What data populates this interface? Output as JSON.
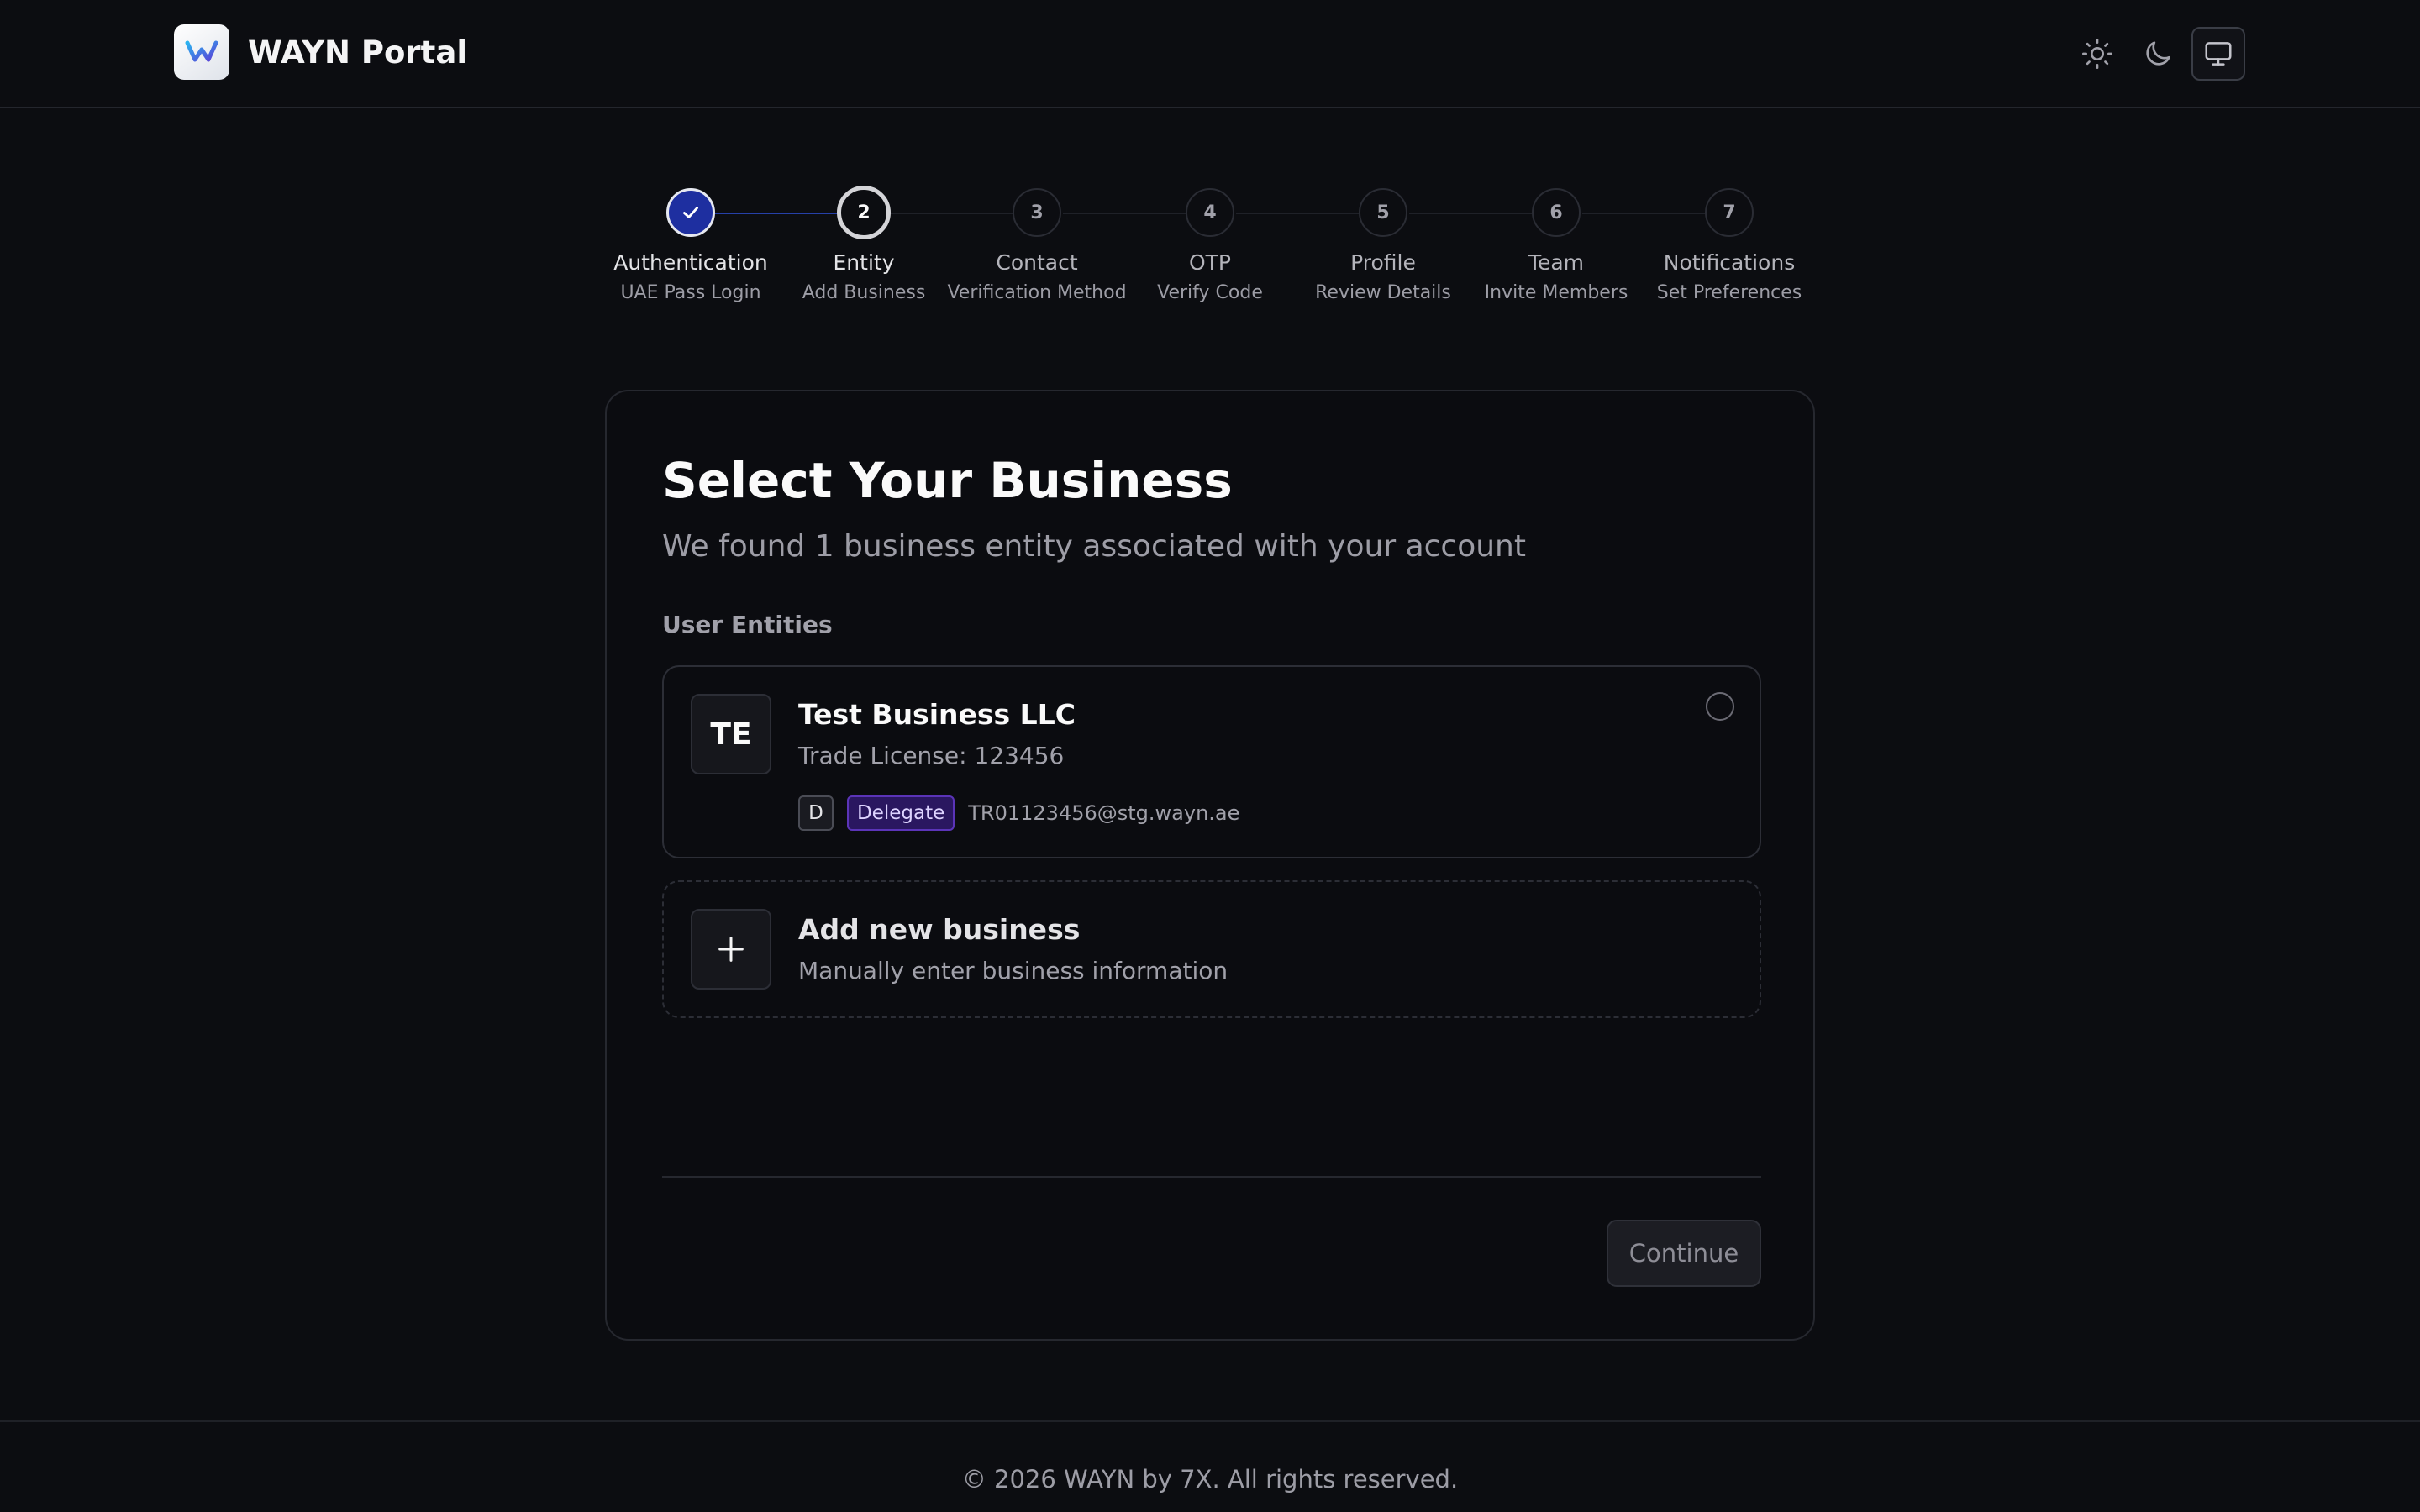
{
  "app": {
    "title": "WAYN Portal",
    "logo_icon": "wayn-logo-icon"
  },
  "theme_toggle": {
    "options": [
      "light-theme-icon",
      "dark-theme-icon",
      "system-theme-icon"
    ],
    "selected": "system"
  },
  "stepper": {
    "steps": [
      {
        "number": "1",
        "label": "Authentication",
        "sub": "UAE Pass Login",
        "state": "done"
      },
      {
        "number": "2",
        "label": "Entity",
        "sub": "Add Business",
        "state": "current"
      },
      {
        "number": "3",
        "label": "Contact",
        "sub": "Verification Method",
        "state": "future"
      },
      {
        "number": "4",
        "label": "OTP",
        "sub": "Verify Code",
        "state": "future"
      },
      {
        "number": "5",
        "label": "Profile",
        "sub": "Review Details",
        "state": "future"
      },
      {
        "number": "6",
        "label": "Team",
        "sub": "Invite Members",
        "state": "future"
      },
      {
        "number": "7",
        "label": "Notifications",
        "sub": "Set Preferences",
        "state": "future"
      }
    ]
  },
  "card": {
    "title": "Select Your Business",
    "subtitle": "We found 1 business entity associated with your account",
    "section_label": "User Entities",
    "entities": [
      {
        "initials": "TE",
        "name": "Test Business LLC",
        "license": "Trade License: 123456",
        "role_letter": "D",
        "role": "Delegate",
        "email": "TR01123456@stg.wayn.ae",
        "selected": false
      }
    ],
    "add_business": {
      "title": "Add new business",
      "subtitle": "Manually enter business information",
      "icon": "plus-icon"
    },
    "continue_label": "Continue"
  },
  "footer": {
    "text": "© 2026 WAYN by 7X. All rights reserved."
  },
  "colors": {
    "background": "#0c0d11",
    "accent": "#1e2fa0",
    "delegate_badge": "#2a1760"
  }
}
